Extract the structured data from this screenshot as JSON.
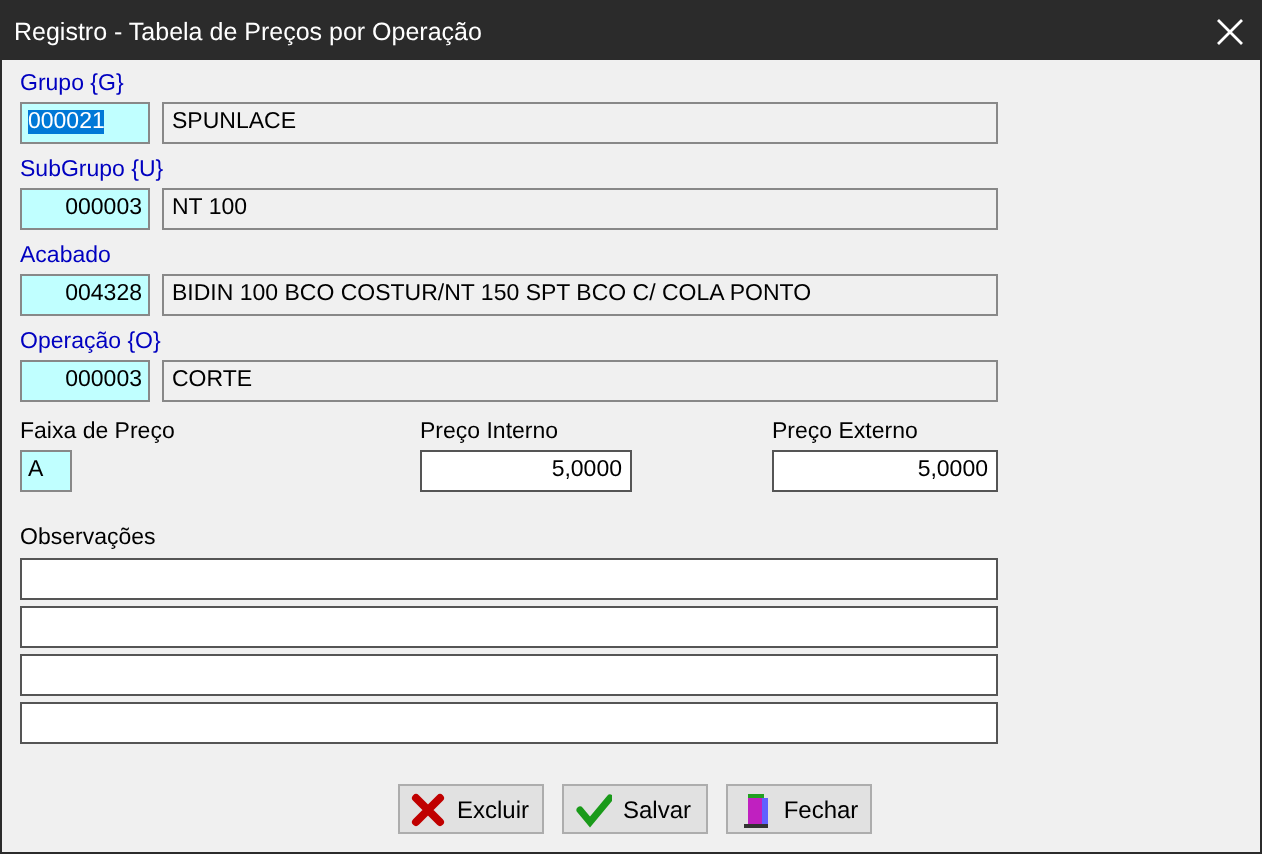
{
  "window": {
    "title": "Registro - Tabela de Preços por Operação"
  },
  "lookups": [
    {
      "label": "Grupo {G}",
      "code": "000021",
      "description": "SPUNLACE",
      "focused": true
    },
    {
      "label": "SubGrupo {U}",
      "code": "000003",
      "description": "NT 100",
      "focused": false
    },
    {
      "label": "Acabado",
      "code": "004328",
      "description": "BIDIN 100 BCO COSTUR/NT 150 SPT BCO C/ COLA PONTO",
      "focused": false
    },
    {
      "label": "Operação {O}",
      "code": "000003",
      "description": "CORTE",
      "focused": false
    }
  ],
  "price_band": {
    "label": "Faixa de Preço",
    "value": "A"
  },
  "internal_price": {
    "label": "Preço Interno",
    "value": "5,0000"
  },
  "external_price": {
    "label": "Preço Externo",
    "value": "5,0000"
  },
  "notes": {
    "label": "Observações",
    "fields": [
      {
        "kind": "line"
      },
      {
        "kind": "line"
      },
      {
        "kind": "line"
      },
      {
        "kind": "line"
      }
    ]
  },
  "buttons": [
    {
      "kind": "delete",
      "label": "Excluir"
    },
    {
      "kind": "save",
      "label": "Salvar"
    },
    {
      "kind": "close",
      "label": "Fechar"
    }
  ]
}
